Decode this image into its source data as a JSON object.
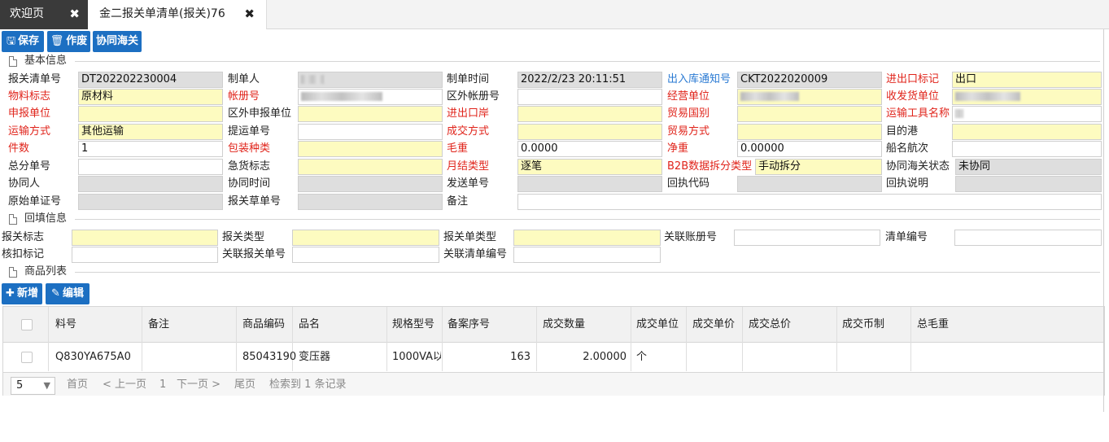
{
  "tabs": [
    {
      "label": "欢迎页",
      "close": "✖"
    },
    {
      "label": "金二报关单清单(报关)76",
      "close": "✖"
    }
  ],
  "toolbar": {
    "save": "保存",
    "void": "作废",
    "sync": "协同海关"
  },
  "sections": {
    "basic": "基本信息",
    "backfill": "回填信息",
    "goods": "商品列表"
  },
  "basic": {
    "r1": {
      "l1": "报关清单号",
      "v1": "DT202202230004",
      "l2": "制单人",
      "l3": "制单时间",
      "v3": "2022/2/23 20:11:51",
      "l4": "出入库通知号",
      "v4": "CKT2022020009",
      "l5": "进出口标记",
      "v5": "出口"
    },
    "r2": {
      "l1": "物料标志",
      "v1": "原材料",
      "l2": "帐册号",
      "l3": "区外帐册号",
      "l4": "经营单位",
      "l5": "收发货单位"
    },
    "r3": {
      "l1": "申报单位",
      "l2": "区外申报单位",
      "l3": "进出口岸",
      "l4": "贸易国别",
      "l5": "运输工具名称"
    },
    "r4": {
      "l1": "运输方式",
      "v1": "其他运输",
      "l2": "提运单号",
      "l3": "成交方式",
      "l4": "贸易方式",
      "l5": "目的港"
    },
    "r5": {
      "l1": "件数",
      "v1": "1",
      "l2": "包装种类",
      "l3": "毛重",
      "v3": "0.0000",
      "l4": "净重",
      "v4": "0.00000",
      "l5": "船名航次"
    },
    "r6": {
      "l1": "总分单号",
      "l2": "急货标志",
      "l3": "月结类型",
      "v3": "逐笔",
      "l4": "B2B数据拆分类型",
      "v4": "手动拆分",
      "l5": "协同海关状态",
      "v5": "未协同"
    },
    "r7": {
      "l1": "协同人",
      "l2": "协同时间",
      "l3": "发送单号",
      "l4": "回执代码",
      "l5": "回执说明"
    },
    "r8": {
      "l1": "原始单证号",
      "l2": "报关草单号",
      "l3": "备注"
    }
  },
  "backfill": {
    "r1": {
      "l1": "报关标志",
      "l2": "报关类型",
      "l3": "报关单类型",
      "l4": "关联账册号",
      "l5": "清单编号"
    },
    "r2": {
      "l1": "核扣标记",
      "l2": "关联报关单号",
      "l3": "关联清单编号"
    }
  },
  "goods_toolbar": {
    "add": "新增",
    "edit": "编辑"
  },
  "grid": {
    "columns": [
      "料号",
      "备注",
      "商品编码",
      "品名",
      "规格型号",
      "备案序号",
      "成交数量",
      "成交单位",
      "成交单价",
      "成交总价",
      "成交币制",
      "总毛重"
    ],
    "rows": [
      {
        "part_no": "Q830YA675A0",
        "remark": "",
        "hs_code": "85043190",
        "name": "变压器",
        "spec": "1000VA以",
        "record_no": "163",
        "qty": "2.00000",
        "unit": "个",
        "price": "",
        "total": "",
        "currency": "",
        "gross": ""
      }
    ]
  },
  "pager": {
    "size": "5",
    "first": "首页",
    "prev": "< 上一页",
    "page": "1",
    "next": "下一页 >",
    "last": "尾页",
    "summary": "检索到 1 条记录"
  }
}
